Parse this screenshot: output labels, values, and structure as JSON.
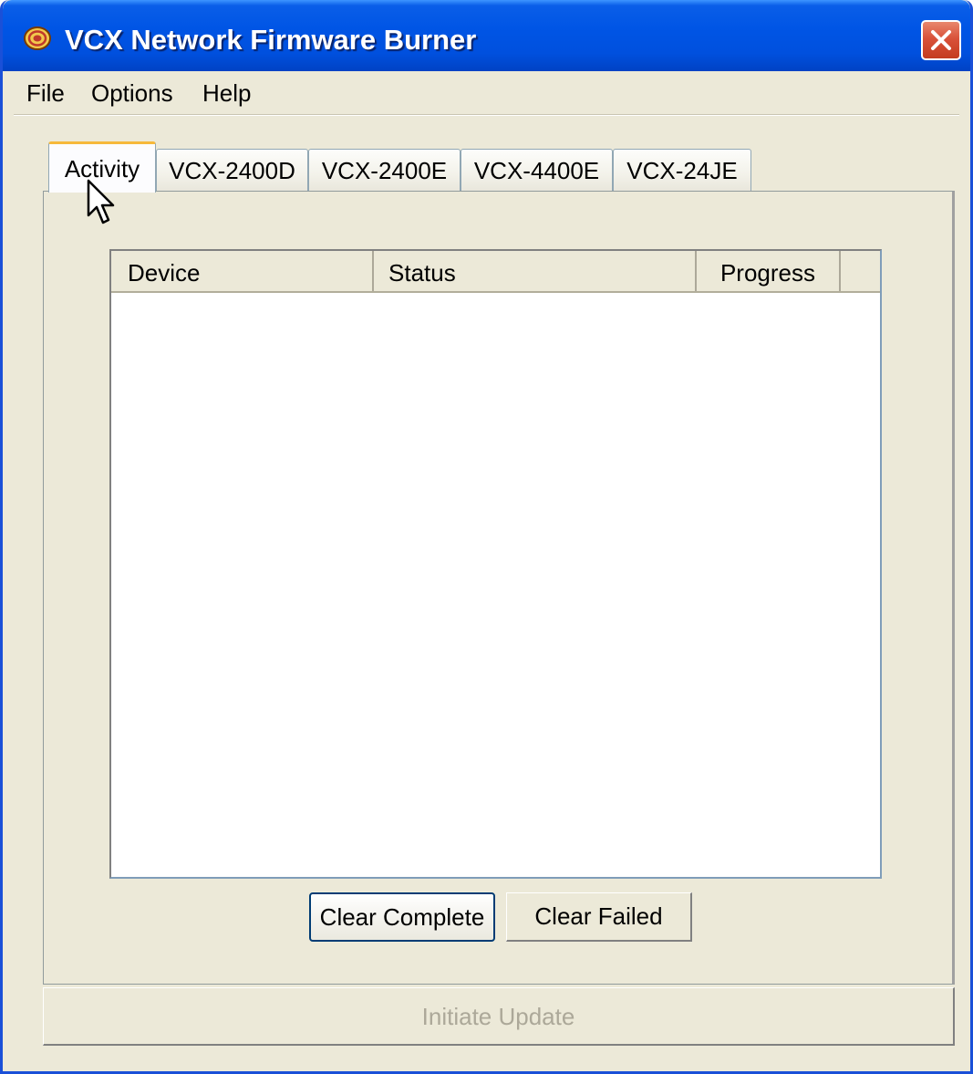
{
  "window": {
    "title": "VCX Network Firmware Burner",
    "title_bar_color": "#0055e5",
    "close_icon": "close-icon"
  },
  "menu": {
    "items": [
      {
        "label": "File"
      },
      {
        "label": "Options"
      },
      {
        "label": "Help"
      }
    ]
  },
  "tabs": {
    "items": [
      {
        "label": "Activity",
        "selected": true
      },
      {
        "label": "VCX-2400D",
        "selected": false
      },
      {
        "label": "VCX-2400E",
        "selected": false
      },
      {
        "label": "VCX-4400E",
        "selected": false
      },
      {
        "label": "VCX-24JE",
        "selected": false
      }
    ]
  },
  "activity": {
    "columns": [
      {
        "label": "Device"
      },
      {
        "label": "Status"
      },
      {
        "label": "Progress"
      }
    ],
    "rows": [],
    "clear_complete_label": "Clear Complete",
    "clear_failed_label": "Clear Failed"
  },
  "footer": {
    "initiate_update_label": "Initiate Update",
    "initiate_update_enabled": false
  }
}
